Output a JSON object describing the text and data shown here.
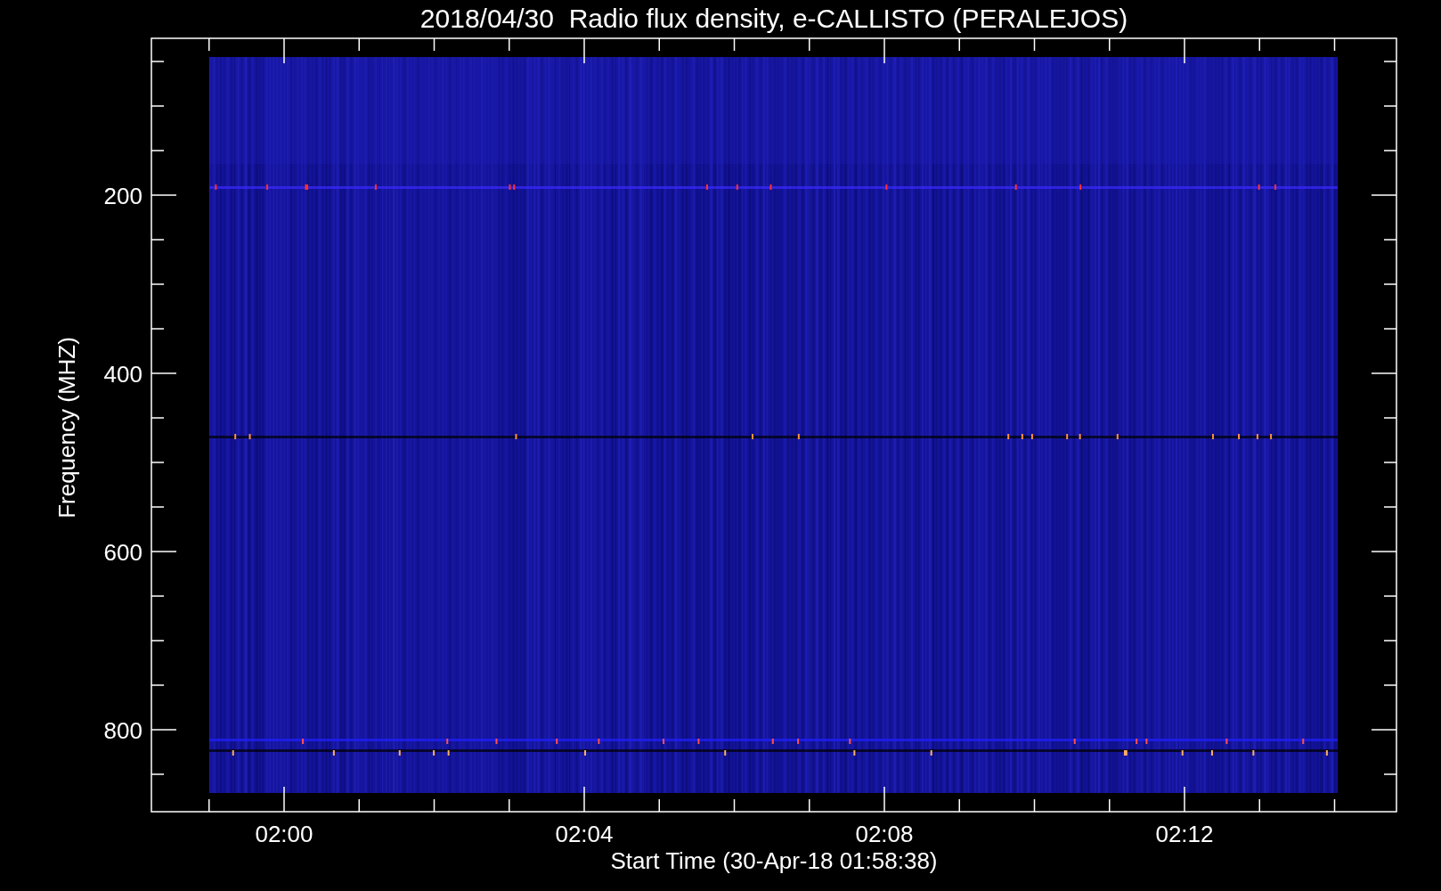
{
  "plot": {
    "title": "2018/04/30  Radio flux density, e-CALLISTO (PERALEJOS)",
    "xlabel": "Start Time (30-Apr-18 01:58:38)",
    "ylabel": "Frequency (MHZ)",
    "yticks": [
      "200",
      "400",
      "600",
      "800"
    ],
    "xticks": [
      "02:00",
      "02:04",
      "02:08",
      "02:12"
    ]
  }
}
